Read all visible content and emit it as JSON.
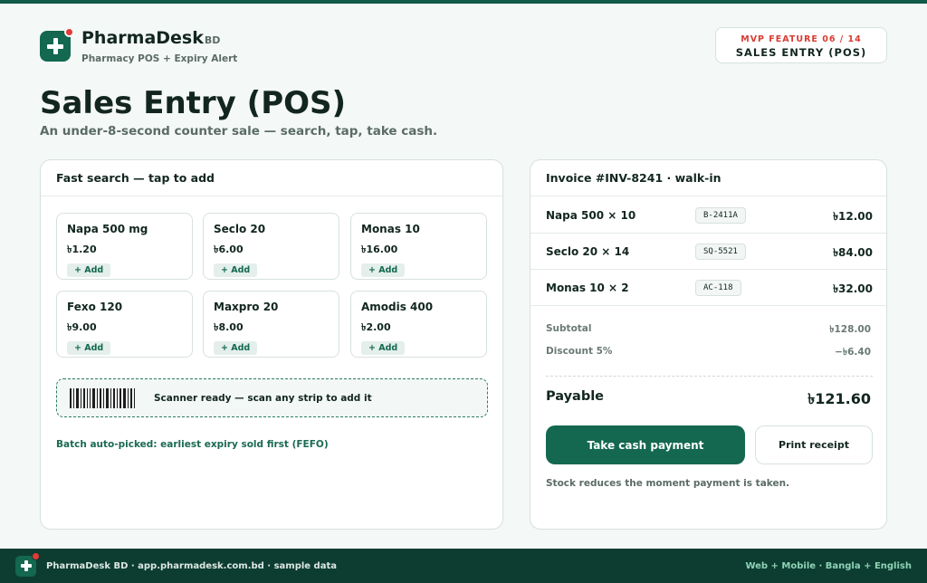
{
  "brand": {
    "name": "PharmaDesk",
    "suffix": "BD",
    "tagline": "Pharmacy POS + Expiry Alert"
  },
  "feature": {
    "kicker": "MVP FEATURE 06 / 14",
    "name": "SALES ENTRY (POS)"
  },
  "page": {
    "title": "Sales Entry (POS)",
    "subtitle": "An under-8-second counter sale — search, tap, take cash."
  },
  "search": {
    "heading": "Fast search — tap to add",
    "add_label": "+ Add",
    "products": [
      {
        "name": "Napa 500 mg",
        "price": "৳1.20"
      },
      {
        "name": "Seclo 20",
        "price": "৳6.00"
      },
      {
        "name": "Monas 10",
        "price": "৳16.00"
      },
      {
        "name": "Fexo 120",
        "price": "৳9.00"
      },
      {
        "name": "Maxpro 20",
        "price": "৳8.00"
      },
      {
        "name": "Amodis 400",
        "price": "৳2.00"
      }
    ],
    "scanner_text": "Scanner ready — scan any strip to add it",
    "fefo_note": "Batch auto-picked: earliest expiry sold first (FEFO)"
  },
  "invoice": {
    "heading": "Invoice #INV-8241 · walk-in",
    "lines": [
      {
        "item": "Napa 500 × 10",
        "batch": "B-2411A",
        "amount": "৳12.00"
      },
      {
        "item": "Seclo 20 × 14",
        "batch": "SQ-5521",
        "amount": "৳84.00"
      },
      {
        "item": "Monas 10 × 2",
        "batch": "AC-118",
        "amount": "৳32.00"
      }
    ],
    "subtotal_label": "Subtotal",
    "subtotal_value": "৳128.00",
    "discount_label": "Discount 5%",
    "discount_value": "−৳6.40",
    "payable_label": "Payable",
    "payable_value": "৳121.60",
    "cash_button": "Take cash payment",
    "print_button": "Print receipt",
    "stock_note": "Stock reduces the moment payment is taken."
  },
  "footer": {
    "left": "PharmaDesk BD · app.pharmadesk.com.bd · sample data",
    "right": "Web + Mobile · Bangla + English"
  },
  "colors": {
    "brand_green": "#13684f",
    "footer_bg": "#0d3d31",
    "accent_red": "#e53935"
  }
}
